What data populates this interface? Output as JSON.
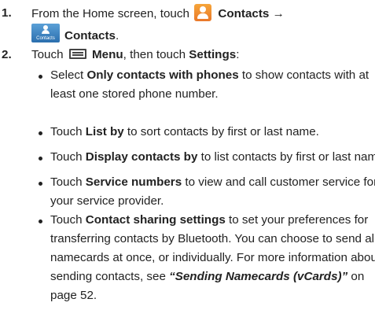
{
  "steps": [
    {
      "number": "1.",
      "text_prefix": "From the Home screen, touch",
      "app_label": "Contacts",
      "arrow": "→",
      "tab_icon_caption": "Contacts",
      "tab_label": "Contacts",
      "tab_suffix": ".",
      "icons": [
        "contacts-app-icon",
        "contacts-tab-icon"
      ]
    },
    {
      "number": "2.",
      "text_touch": "Touch",
      "menu_label": "Menu",
      "text_then": ", then touch",
      "settings_label": "Settings",
      "text_colon": ":",
      "icons": [
        "menu-key-icon"
      ]
    }
  ],
  "bullets": [
    {
      "lines": [
        [
          {
            "t": "Select "
          },
          {
            "t": "Only contacts with phones",
            "b": true
          },
          {
            "t": " to show contacts with at"
          }
        ],
        [
          {
            "t": "least one stored phone number."
          }
        ]
      ]
    },
    {
      "lines": [
        [
          {
            "t": "Touch "
          },
          {
            "t": "List by",
            "b": true
          },
          {
            "t": " to sort contacts by first or last name."
          }
        ]
      ]
    },
    {
      "lines": [
        [
          {
            "t": "Touch "
          },
          {
            "t": "Display contacts by",
            "b": true
          },
          {
            "t": " to list contacts by first or last name."
          }
        ]
      ]
    },
    {
      "lines": [
        [
          {
            "t": "Touch "
          },
          {
            "t": "Service numbers",
            "b": true
          },
          {
            "t": " to view and call customer service for"
          }
        ],
        [
          {
            "t": "your service provider."
          }
        ]
      ]
    },
    {
      "lines": [
        [
          {
            "t": "Touch "
          },
          {
            "t": "Contact sharing settings",
            "b": true
          },
          {
            "t": " to set your preferences for"
          }
        ],
        [
          {
            "t": "transferring contacts by Bluetooth. You can choose to send all"
          }
        ],
        [
          {
            "t": "namecards at once, or individually. For more information about"
          }
        ],
        [
          {
            "t": "sending contacts, see "
          },
          {
            "t": "“Sending Namecards (vCards)”",
            "i": true
          },
          {
            "t": " on"
          }
        ],
        [
          {
            "t": "page 52."
          }
        ]
      ]
    }
  ]
}
